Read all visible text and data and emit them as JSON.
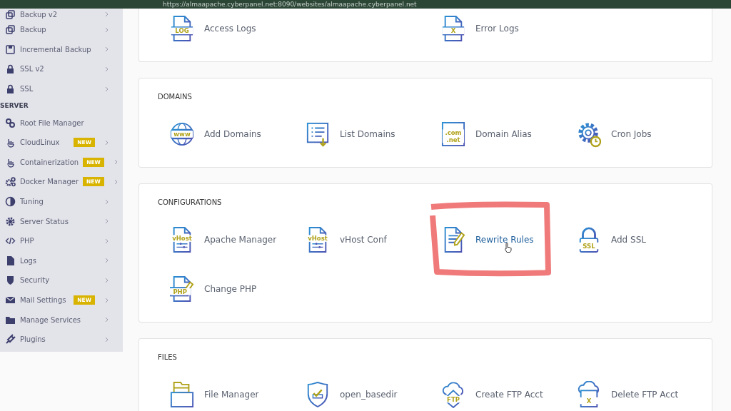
{
  "browser": {
    "url": "https://almaapache.cyberpanel.net:8090/websites/almaapache.cyberpanel.net"
  },
  "sidebar": {
    "items": [
      {
        "kind": "item",
        "label": "Backup v2"
      },
      {
        "kind": "item",
        "label": "Backup"
      },
      {
        "kind": "item",
        "label": "Incremental Backup"
      },
      {
        "kind": "item",
        "label": "SSL v2"
      },
      {
        "kind": "item",
        "label": "SSL"
      },
      {
        "kind": "heading",
        "label": "SERVER"
      },
      {
        "kind": "item",
        "label": "Root File Manager",
        "chevron": false
      },
      {
        "kind": "item",
        "label": "CloudLinux",
        "badge": "NEW"
      },
      {
        "kind": "item",
        "label": "Containerization",
        "badge": "NEW"
      },
      {
        "kind": "item",
        "label": "Docker Manager",
        "badge": "NEW"
      },
      {
        "kind": "item",
        "label": "Tuning"
      },
      {
        "kind": "item",
        "label": "Server Status"
      },
      {
        "kind": "item",
        "label": "PHP"
      },
      {
        "kind": "item",
        "label": "Logs"
      },
      {
        "kind": "item",
        "label": "Security"
      },
      {
        "kind": "item",
        "label": "Mail Settings",
        "badge": "NEW"
      },
      {
        "kind": "item",
        "label": "Manage Services"
      },
      {
        "kind": "item",
        "label": "Plugins"
      }
    ]
  },
  "sections": [
    {
      "items": [
        {
          "label": "Access Logs",
          "icon_text": [
            "LOG"
          ],
          "hovered": false,
          "annotated": false
        },
        {
          "label": "Error Logs",
          "icon_text": [
            "X"
          ],
          "hovered": false,
          "annotated": false
        }
      ]
    },
    {
      "title": "DOMAINS",
      "items": [
        {
          "label": "Add Domains",
          "icon_text": [
            "www"
          ],
          "hovered": false,
          "annotated": false
        },
        {
          "label": "List Domains",
          "hovered": false,
          "annotated": false
        },
        {
          "label": "Domain Alias",
          "icon_text": [
            ".com",
            ".net"
          ],
          "hovered": false,
          "annotated": false
        },
        {
          "label": "Cron Jobs",
          "hovered": false,
          "annotated": false
        }
      ]
    },
    {
      "title": "CONFIGURATIONS",
      "items": [
        {
          "label": "Apache Manager",
          "icon_text": [
            "vHost"
          ],
          "hovered": false,
          "annotated": false
        },
        {
          "label": "vHost Conf",
          "icon_text": [
            "vHost"
          ],
          "hovered": false,
          "annotated": false
        },
        {
          "label": "Rewrite Rules",
          "hovered": true,
          "annotated": true
        },
        {
          "label": "Add SSL",
          "icon_text": [
            "SSL"
          ],
          "hovered": false,
          "annotated": false
        },
        {
          "label": "Change PHP",
          "icon_text": [
            "PHP"
          ],
          "hovered": false,
          "annotated": false
        }
      ]
    },
    {
      "title": "FILES",
      "items": [
        {
          "label": "File Manager",
          "hovered": false,
          "annotated": false
        },
        {
          "label": "open_basedir",
          "hovered": false,
          "annotated": false
        },
        {
          "label": "Create FTP Acct",
          "icon_text": [
            "FTP"
          ],
          "hovered": false,
          "annotated": false
        },
        {
          "label": "Delete FTP Acct",
          "icon_text": [
            "X"
          ],
          "hovered": false,
          "annotated": false
        }
      ]
    }
  ]
}
